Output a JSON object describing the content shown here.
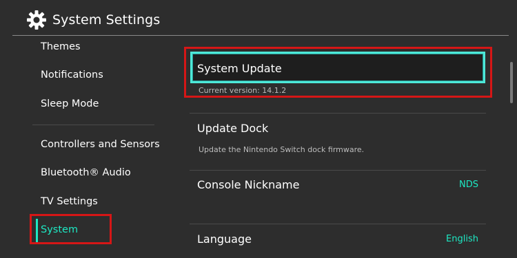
{
  "header": {
    "title": "System Settings",
    "icon": "gear-icon"
  },
  "sidebar": {
    "items": [
      {
        "label": "Themes"
      },
      {
        "label": "Notifications"
      },
      {
        "label": "Sleep Mode"
      },
      {
        "label": "Controllers and Sensors"
      },
      {
        "label": "Bluetooth® Audio"
      },
      {
        "label": "TV Settings"
      },
      {
        "label": "System",
        "selected": true
      }
    ]
  },
  "main": {
    "rows": [
      {
        "title": "System Update",
        "subtitle": "Current version: 14.1.2"
      },
      {
        "title": "Update Dock",
        "subtitle": "Update the Nintendo Switch dock firmware."
      },
      {
        "title": "Console Nickname",
        "value": "NDS"
      },
      {
        "title": "Language",
        "value": "English"
      }
    ]
  },
  "colors": {
    "background": "#2d2d2d",
    "accent": "#1de9c4",
    "highlight_outline": "#d61616",
    "selection_border": "#4de8d8"
  }
}
